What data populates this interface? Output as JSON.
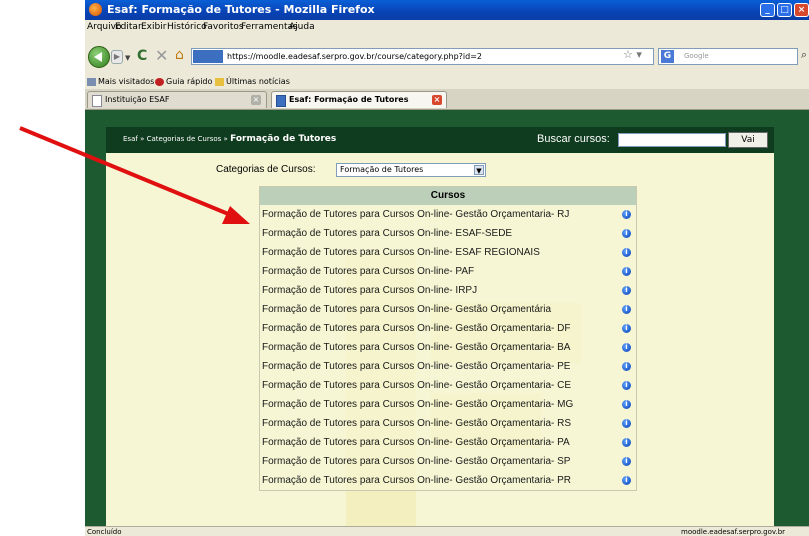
{
  "window": {
    "title": "Esaf: Formação de Tutores - Mozilla Firefox"
  },
  "menu": [
    "Arquivo",
    "Editar",
    "Exibir",
    "Histórico",
    "Favoritos",
    "Ferramentas",
    "Ajuda"
  ],
  "nav": {
    "url": "https://moodle.eadesaf.serpro.gov.br/course/category.php?id=2",
    "search_placeholder": "Google"
  },
  "bookmarks": [
    "Mais visitados",
    "Guia rápido",
    "Últimas notícias"
  ],
  "tabs": [
    {
      "label": "Instituição ESAF"
    },
    {
      "label": "Esaf: Formação de Tutores"
    }
  ],
  "page": {
    "breadcrumb_root": "Esaf",
    "breadcrumb_sep": "»",
    "breadcrumb_mid": "Categorias de Cursos",
    "breadcrumb_current": "Formação de Tutores",
    "search_label": "Buscar cursos:",
    "search_button": "Vai",
    "category_label": "Categorias de Cursos:",
    "category_selected": "Formação de Tutores",
    "courses_header": "Cursos",
    "courses": [
      "Formação de Tutores para Cursos On-line- Gestão Orçamentaria- RJ",
      "Formação de Tutores para Cursos On-line- ESAF-SEDE",
      "Formação de Tutores para Cursos On-line- ESAF REGIONAIS",
      "Formação de Tutores para Cursos On-line- PAF",
      "Formação de Tutores para Cursos On-line- IRPJ",
      "Formação de Tutores para Cursos On-line- Gestão Orçamentária",
      "Formação de Tutores para Cursos On-line- Gestão Orçamentaria- DF",
      "Formação de Tutores para Cursos On-line- Gestão Orçamentaria- BA",
      "Formação de Tutores para Cursos On-line- Gestão Orçamentaria- PE",
      "Formação de Tutores para Cursos On-line- Gestão Orçamentaria- CE",
      "Formação de Tutores para Cursos On-line- Gestão Orçamentaria- MG",
      "Formação de Tutores para Cursos On-line- Gestão Orçamentaria- RS",
      "Formação de Tutores para Cursos On-line- Gestão Orçamentaria- PA",
      "Formação de Tutores para Cursos On-line- Gestão Orçamentaria- SP",
      "Formação de Tutores para Cursos On-line- Gestão Orçamentaria- PR"
    ]
  },
  "status": {
    "left": "Concluído",
    "right": "moodle.eadesaf.serpro.gov.br"
  },
  "colors": {
    "annotation_arrow": "#e01010",
    "page_frame": "#1d5a30",
    "page_bg": "#f6f6d5",
    "table_header": "#bccfb9"
  }
}
